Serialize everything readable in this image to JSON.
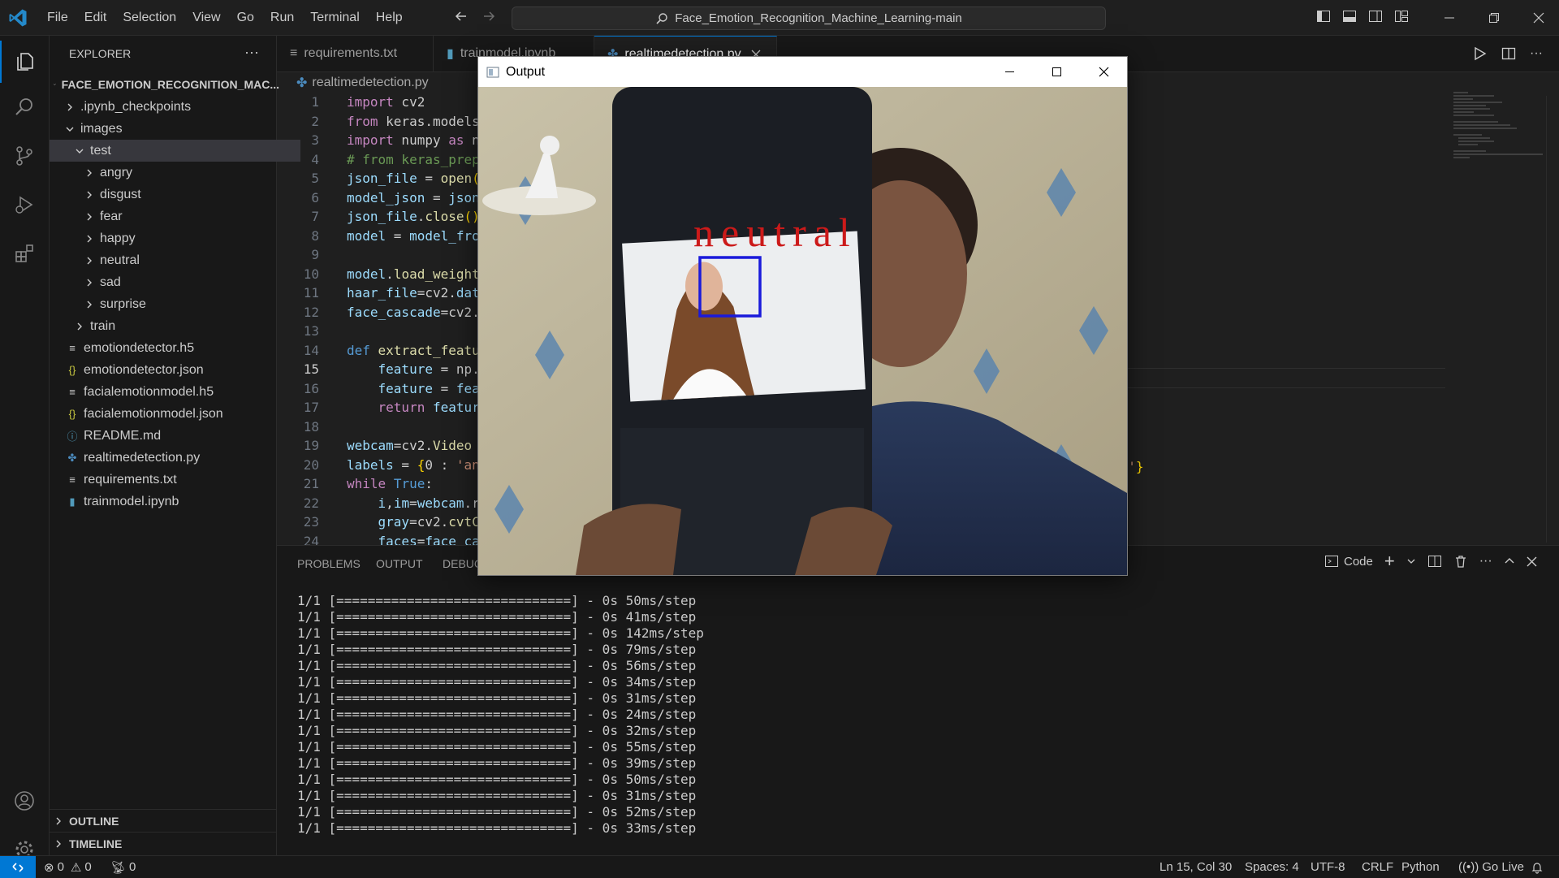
{
  "menu": [
    "File",
    "Edit",
    "Selection",
    "View",
    "Go",
    "Run",
    "Terminal",
    "Help"
  ],
  "command_center": {
    "text": "Face_Emotion_Recognition_Machine_Learning-main"
  },
  "sidebar": {
    "header": "EXPLORER",
    "root": "FACE_EMOTION_RECOGNITION_MAC...",
    "tree": [
      {
        "label": ".ipynb_checkpoints"
      },
      {
        "label": "images"
      },
      {
        "label": "test"
      },
      {
        "label": "angry"
      },
      {
        "label": "disgust"
      },
      {
        "label": "fear"
      },
      {
        "label": "happy"
      },
      {
        "label": "neutral"
      },
      {
        "label": "sad"
      },
      {
        "label": "surprise"
      },
      {
        "label": "train"
      },
      {
        "label": "emotiondetector.h5"
      },
      {
        "label": "emotiondetector.json"
      },
      {
        "label": "facialemotionmodel.h5"
      },
      {
        "label": "facialemotionmodel.json"
      },
      {
        "label": "README.md"
      },
      {
        "label": "realtimedetection.py"
      },
      {
        "label": "requirements.txt"
      },
      {
        "label": "trainmodel.ipynb"
      }
    ],
    "outline": "OUTLINE",
    "timeline": "TIMELINE"
  },
  "tabs": [
    {
      "label": "requirements.txt"
    },
    {
      "label": "trainmodel.ipynb"
    },
    {
      "label": "realtimedetection.py"
    }
  ],
  "breadcrumb": "realtimedetection.py",
  "code": {
    "line_numbers": [
      "1",
      "2",
      "3",
      "4",
      "5",
      "6",
      "7",
      "8",
      "9",
      "10",
      "11",
      "12",
      "13",
      "14",
      "15",
      "16",
      "17",
      "18",
      "19",
      "20",
      "21",
      "22",
      "23",
      "24"
    ],
    "lines": [
      "import cv2",
      "from keras.models",
      "import numpy as n",
      "# from keras_prep",
      "json_file = open(",
      "model_json = json",
      "json_file.close()",
      "model = model_fro",
      "",
      "model.load_weight",
      "haar_file=cv2.dat",
      "face_cascade=cv2.",
      "",
      "def extract_featu",
      "    feature = np.",
      "    feature = fea",
      "    return featur",
      "",
      "webcam=cv2.Video",
      "labels = {0 : 'an",
      "while True:",
      "    i,im=webcam.r",
      "    gray=cv2.cvtC",
      "    faces=face_ca"
    ],
    "tail": "se'}"
  },
  "panel": {
    "tabs": [
      "PROBLEMS",
      "OUTPUT",
      "DEBUG"
    ],
    "terminal_profile": "Code",
    "terminal_lines": [
      "1/1 [==============================] - 0s 50ms/step",
      "1/1 [==============================] - 0s 41ms/step",
      "1/1 [==============================] - 0s 142ms/step",
      "1/1 [==============================] - 0s 79ms/step",
      "1/1 [==============================] - 0s 56ms/step",
      "1/1 [==============================] - 0s 34ms/step",
      "1/1 [==============================] - 0s 31ms/step",
      "1/1 [==============================] - 0s 24ms/step",
      "1/1 [==============================] - 0s 32ms/step",
      "1/1 [==============================] - 0s 55ms/step",
      "1/1 [==============================] - 0s 39ms/step",
      "1/1 [==============================] - 0s 50ms/step",
      "1/1 [==============================] - 0s 31ms/step",
      "1/1 [==============================] - 0s 52ms/step",
      "1/1 [==============================] - 0s 33ms/step"
    ]
  },
  "statusbar": {
    "errors": "0",
    "warnings": "0",
    "ports": "0",
    "position": "Ln 15, Col 30",
    "spaces": "Spaces: 4",
    "encoding": "UTF-8",
    "eol": "CRLF",
    "language": "Python",
    "go_live": "Go Live"
  },
  "output_window": {
    "title": "Output",
    "prediction": "neutral"
  },
  "colors": {
    "accent": "#0078d4",
    "prediction_text": "#cc1a1a",
    "face_box": "#1a1adb"
  },
  "icons": [
    "vscode-logo-icon",
    "files-icon",
    "search-icon",
    "source-control-icon",
    "run-debug-icon",
    "extensions-icon",
    "account-icon",
    "gear-icon",
    "run-icon",
    "split-editor-icon",
    "close-icon",
    "chevron-right-icon",
    "chevron-down-icon",
    "bell-icon"
  ]
}
